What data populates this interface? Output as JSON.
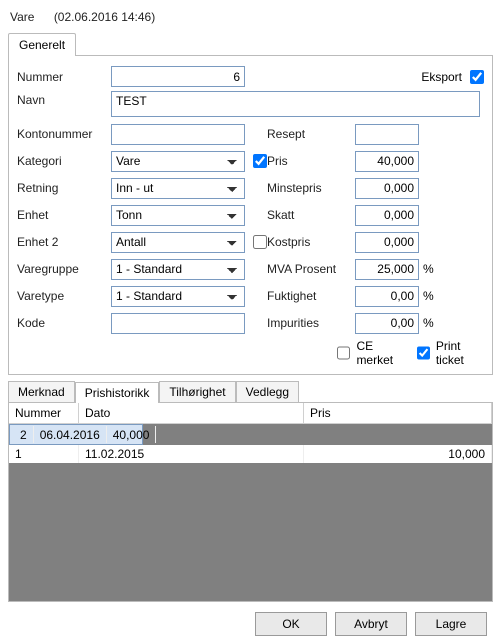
{
  "header": {
    "title": "Vare",
    "timestamp": "(02.06.2016 14:46)"
  },
  "mainTab": "Generelt",
  "left": {
    "nummer_label": "Nummer",
    "nummer_value": "6",
    "navn_label": "Navn",
    "navn_value": "TEST",
    "kontonummer_label": "Kontonummer",
    "kontonummer_value": "",
    "kategori_label": "Kategori",
    "kategori_value": "Vare",
    "retning_label": "Retning",
    "retning_value": "Inn - ut",
    "enhet_label": "Enhet",
    "enhet_value": "Tonn",
    "enhet2_label": "Enhet 2",
    "enhet2_value": "Antall",
    "varegruppe_label": "Varegruppe",
    "varegruppe_value": "1 - Standard",
    "varetype_label": "Varetype",
    "varetype_value": "1 - Standard",
    "kode_label": "Kode",
    "kode_value": ""
  },
  "right": {
    "eksport_label": "Eksport",
    "resept_label": "Resept",
    "resept_value": "",
    "pris_label": "Pris",
    "pris_value": "40,000",
    "minstepris_label": "Minstepris",
    "minstepris_value": "0,000",
    "skatt_label": "Skatt",
    "skatt_value": "0,000",
    "kostpris_label": "Kostpris",
    "kostpris_value": "0,000",
    "mva_label": "MVA Prosent",
    "mva_value": "25,000",
    "fuktighet_label": "Fuktighet",
    "fuktighet_value": "0,00",
    "impurities_label": "Impurities",
    "impurities_value": "0,00",
    "ce_label": "CE merket",
    "print_label": "Print ticket",
    "pct": "%"
  },
  "subtabs": {
    "merknad": "Merknad",
    "prishistorikk": "Prishistorikk",
    "tilhorighet": "Tilhørighet",
    "vedlegg": "Vedlegg"
  },
  "grid": {
    "h_nummer": "Nummer",
    "h_dato": "Dato",
    "h_pris": "Pris",
    "rows": [
      {
        "nummer": "2",
        "dato": "06.04.2016",
        "pris": "40,000"
      },
      {
        "nummer": "1",
        "dato": "11.02.2015",
        "pris": "10,000"
      }
    ]
  },
  "buttons": {
    "ok": "OK",
    "avbryt": "Avbryt",
    "lagre": "Lagre"
  }
}
